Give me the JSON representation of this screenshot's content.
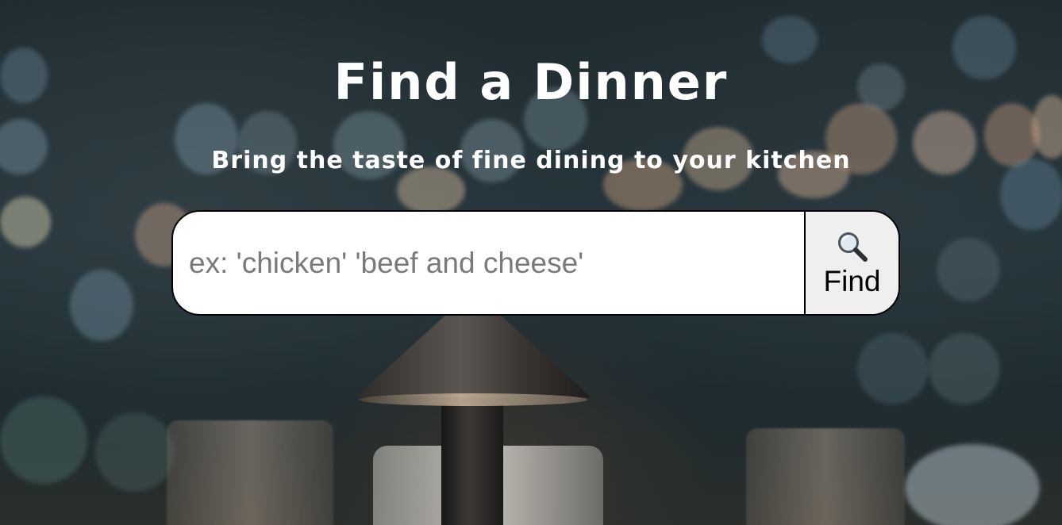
{
  "page": {
    "title": "Find a Dinner",
    "subtitle": "Bring the taste of fine dining to your kitchen"
  },
  "search": {
    "placeholder": "ex: 'chicken' 'beef and cheese'",
    "value": "",
    "button_label": "Find",
    "button_icon": "magnifying-glass-icon"
  },
  "colors": {
    "text": "#ffffff",
    "button_bg": "#efefef",
    "input_bg": "#ffffff",
    "border": "#000000"
  }
}
